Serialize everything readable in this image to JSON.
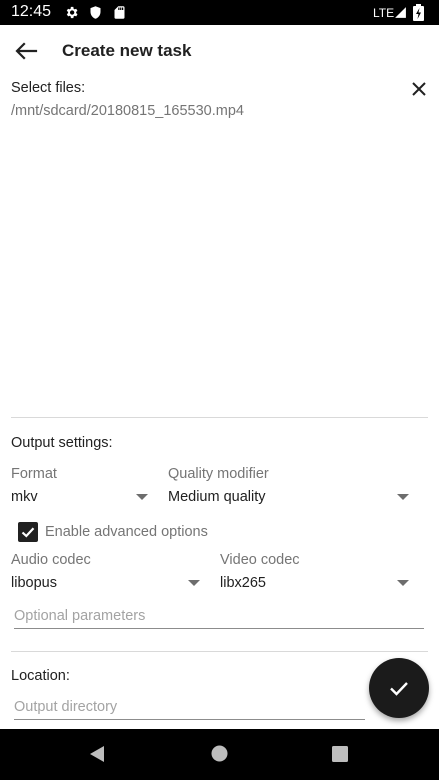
{
  "status_bar": {
    "time": "12:45",
    "network": "LTE",
    "icons": [
      "settings-icon",
      "shield-icon",
      "sd-card-icon",
      "signal-icon",
      "battery-icon"
    ]
  },
  "app_bar": {
    "title": "Create new task",
    "back_icon": "arrow-back-icon"
  },
  "files": {
    "label": "Select files:",
    "selected_path": "/mnt/sdcard/20180815_165530.mp4",
    "clear_icon": "close-icon"
  },
  "output_settings": {
    "label": "Output settings:",
    "format": {
      "label": "Format",
      "value": "mkv"
    },
    "quality": {
      "label": "Quality modifier",
      "value": "Medium quality"
    },
    "advanced": {
      "label": "Enable advanced options",
      "checked": true
    },
    "audio_codec": {
      "label": "Audio codec",
      "value": "libopus"
    },
    "video_codec": {
      "label": "Video codec",
      "value": "libx265"
    },
    "parameters": {
      "placeholder": "Optional parameters",
      "value": ""
    }
  },
  "location": {
    "label": "Location:",
    "directory": {
      "placeholder": "Output directory",
      "value": ""
    }
  },
  "fab": {
    "icon": "check-icon"
  },
  "nav_bar": {
    "icons": [
      "nav-back-icon",
      "nav-home-icon",
      "nav-recents-icon"
    ]
  },
  "colors": {
    "status_bar": "#000000",
    "fab": "#1b1b1b",
    "divider": "#d9d9d9",
    "placeholder_text": "#a3a3a3"
  }
}
